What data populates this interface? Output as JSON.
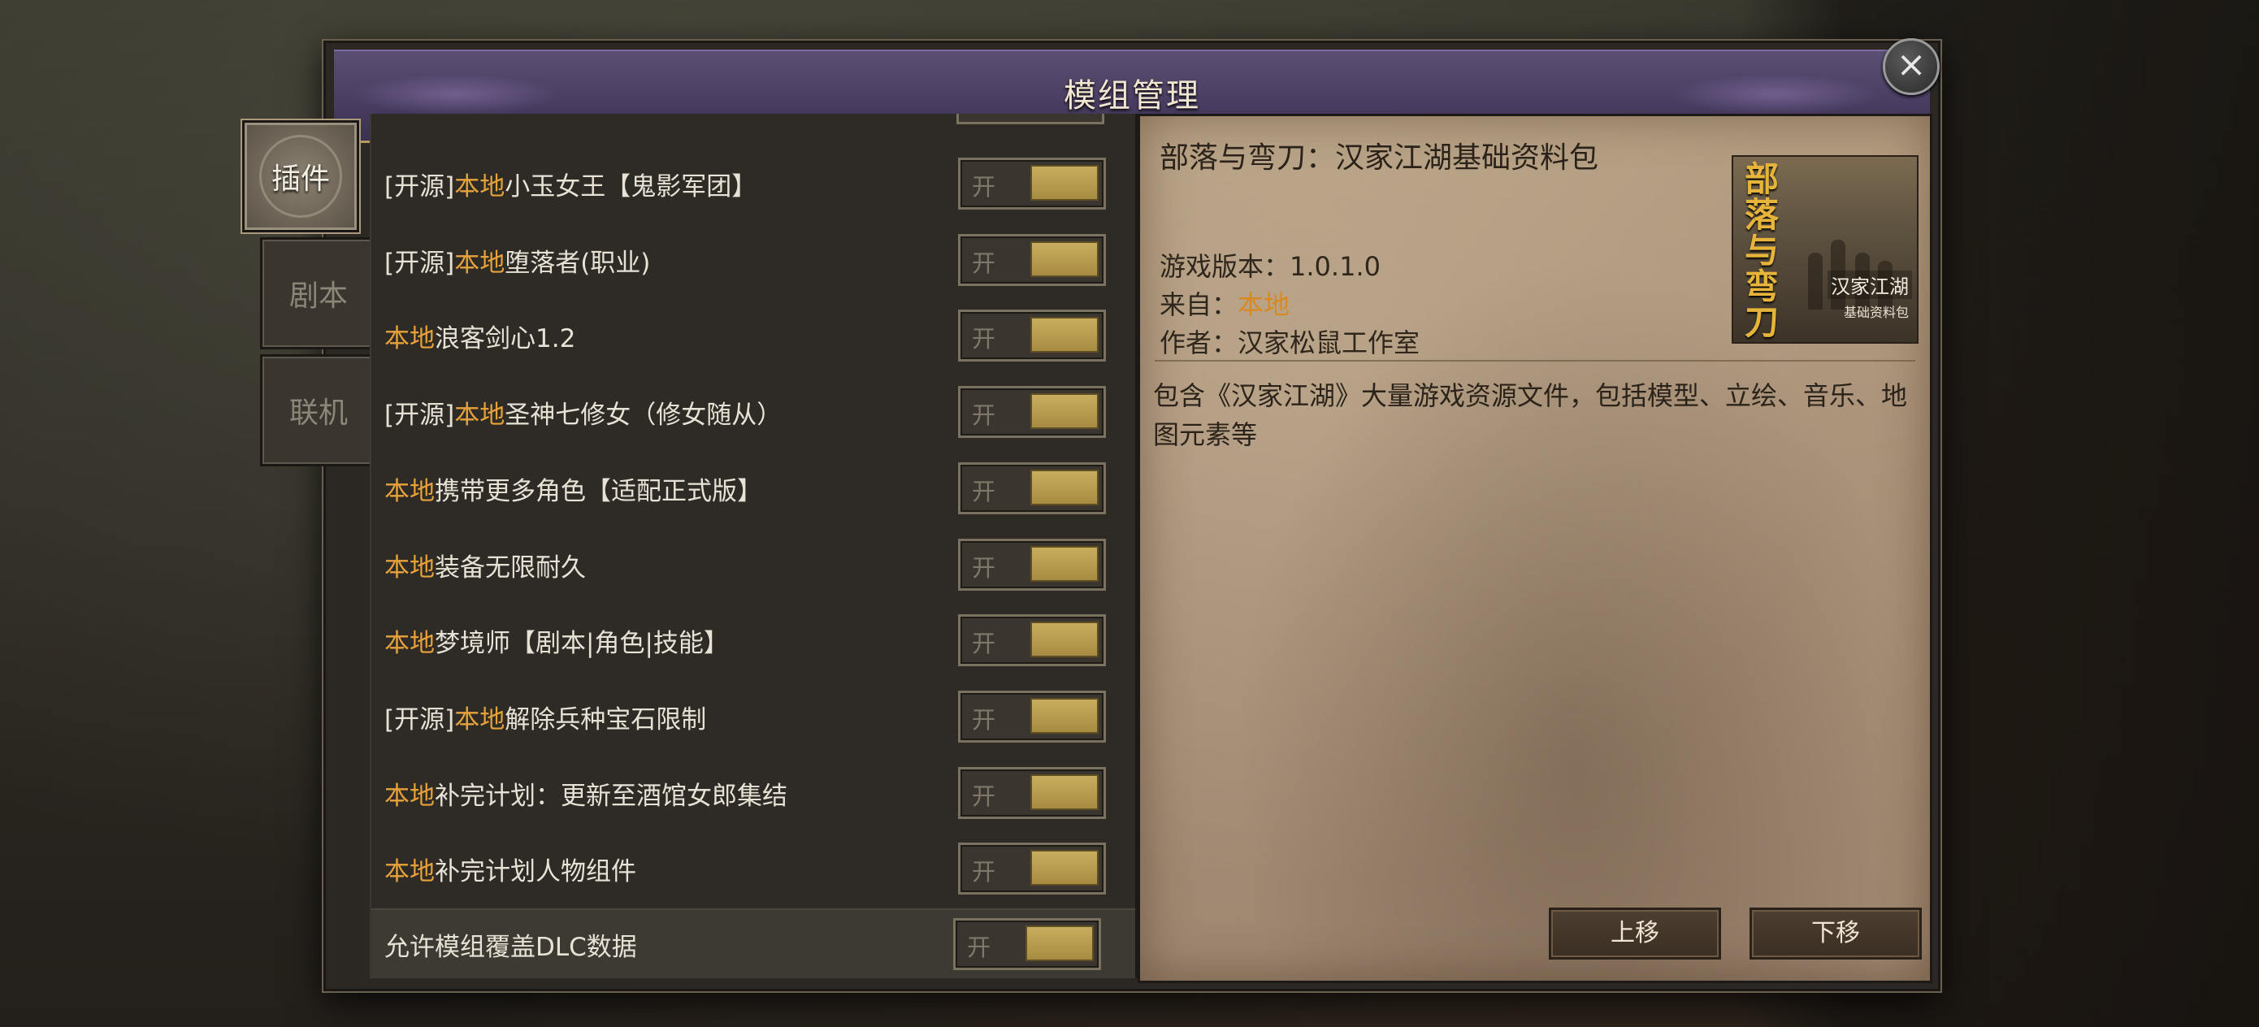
{
  "window": {
    "title": "模组管理",
    "close_icon": "close-icon"
  },
  "side_tabs": [
    {
      "label": "插件",
      "active": true
    },
    {
      "label": "剧本",
      "active": false
    },
    {
      "label": "联机",
      "active": false
    }
  ],
  "mod_list": [
    {
      "prefix": "[开源]",
      "tag": "本地",
      "name": "小玉女王【鬼影军团】",
      "toggle": "开"
    },
    {
      "prefix": "[开源]",
      "tag": "本地",
      "name": "堕落者(职业)",
      "toggle": "开"
    },
    {
      "prefix": "",
      "tag": "本地",
      "name": "浪客剑心1.2",
      "toggle": "开"
    },
    {
      "prefix": "[开源]",
      "tag": "本地",
      "name": "圣神七修女（修女随从）",
      "toggle": "开"
    },
    {
      "prefix": "",
      "tag": "本地",
      "name": "携带更多角色【适配正式版】",
      "toggle": "开"
    },
    {
      "prefix": "",
      "tag": "本地",
      "name": "装备无限耐久",
      "toggle": "开"
    },
    {
      "prefix": "",
      "tag": "本地",
      "name": "梦境师【剧本|角色|技能】",
      "toggle": "开"
    },
    {
      "prefix": "[开源]",
      "tag": "本地",
      "name": "解除兵种宝石限制",
      "toggle": "开"
    },
    {
      "prefix": "",
      "tag": "本地",
      "name": "补完计划：更新至酒馆女郎集结",
      "toggle": "开"
    },
    {
      "prefix": "",
      "tag": "本地",
      "name": "补完计划人物组件",
      "toggle": "开"
    }
  ],
  "dlc_option": {
    "label": "允许模组覆盖DLC数据",
    "toggle": "开"
  },
  "detail": {
    "title": "部落与弯刀：汉家江湖基础资料包",
    "version_label": "游戏版本：",
    "version": "1.0.1.0",
    "source_label": "来自：",
    "source": "本地",
    "author_label": "作者：",
    "author": "汉家松鼠工作室",
    "description": "包含《汉家江湖》大量游戏资源文件，包括模型、立绘、音乐、地图元素等",
    "cover": {
      "main": "部落与弯刀",
      "sub": "汉家江湖",
      "sub2": "基础资料包"
    }
  },
  "buttons": {
    "move_up": "上移",
    "move_down": "下移"
  },
  "colors": {
    "local_tag": "#e6a13a",
    "toggle_knob": "#c9ad5e",
    "title_bar": "#4a3e62"
  }
}
